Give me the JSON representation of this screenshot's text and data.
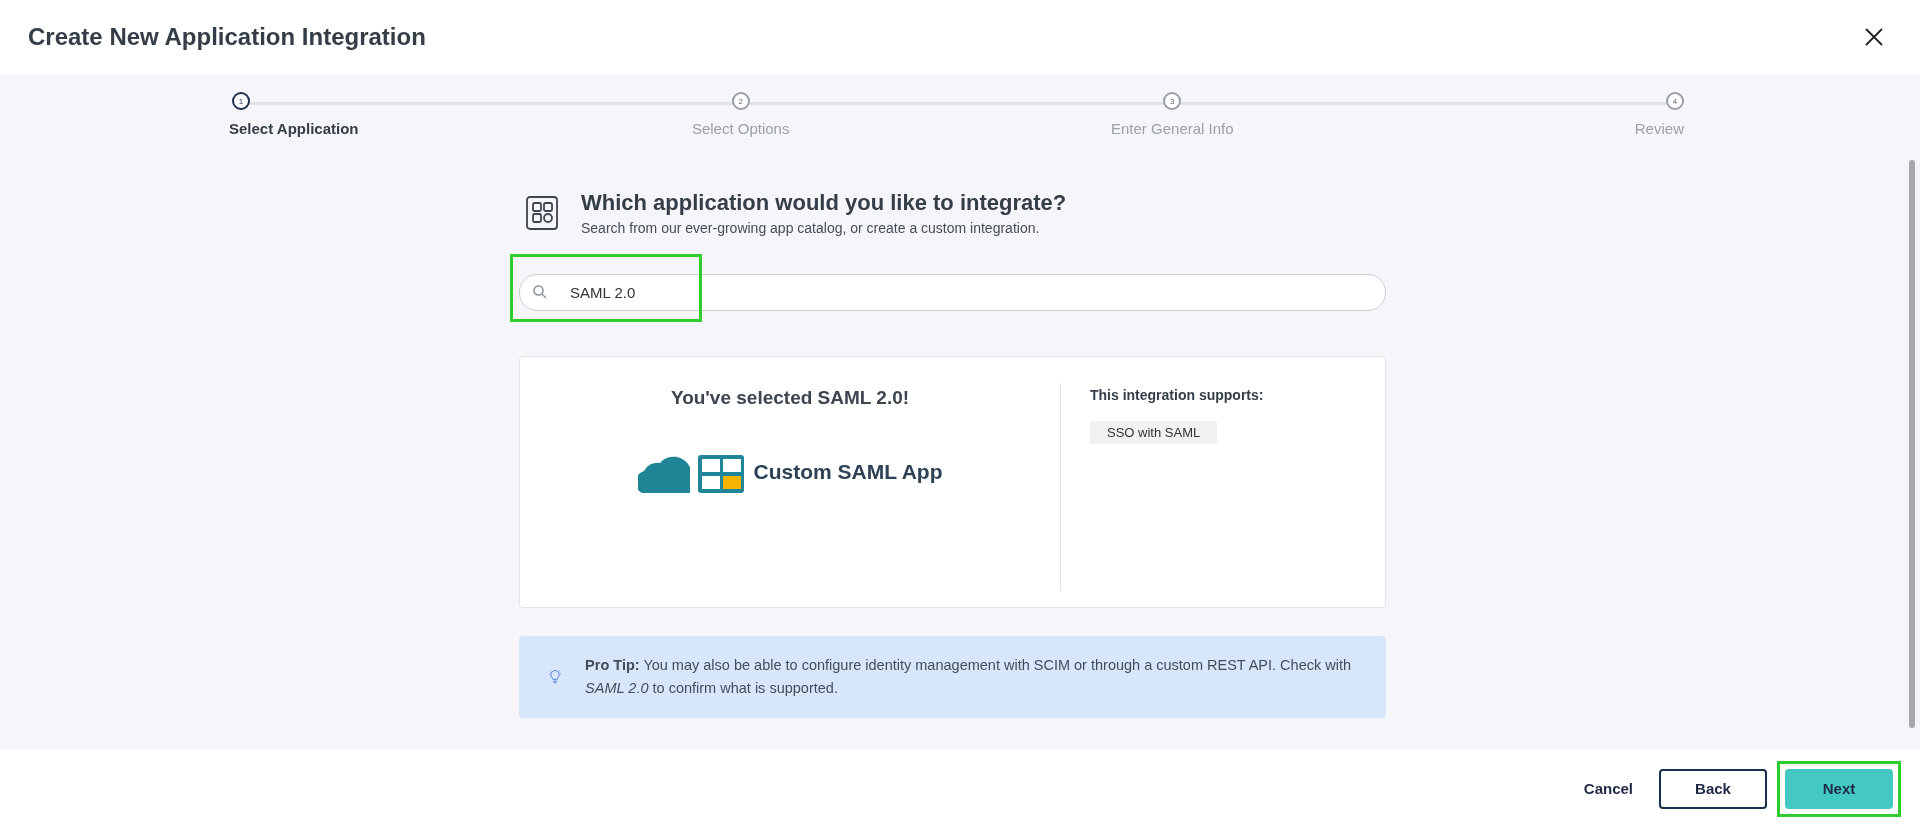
{
  "window": {
    "title": "Create New Application Integration"
  },
  "steps": [
    {
      "number": "1",
      "label": "Select Application",
      "selected": true
    },
    {
      "number": "2",
      "label": "Select Options",
      "selected": false
    },
    {
      "number": "3",
      "label": "Enter General Info",
      "selected": false
    },
    {
      "number": "4",
      "label": "Review",
      "selected": false
    }
  ],
  "heading": {
    "title": "Which application would you like to integrate?",
    "subtitle": "Search from our ever-growing app catalog, or create a custom integration."
  },
  "search": {
    "value": "SAML 2.0",
    "highlighted": true
  },
  "selection": {
    "title": "You've selected SAML 2.0!",
    "app_name": "Custom SAML App",
    "supports_title": "This integration supports:",
    "supports": [
      "SSO with SAML"
    ]
  },
  "tip": {
    "text": "**Pro Tip:** You may also be able to configure identity management with SCIM or through a custom REST API. Check with *SAML 2.0* to confirm what is supported."
  },
  "buttons": [
    {
      "kind": "link",
      "label": "Cancel",
      "highlighted": false
    },
    {
      "kind": "outline",
      "label": "Back",
      "highlighted": false
    },
    {
      "kind": "primary",
      "label": "Next",
      "highlighted": true
    }
  ]
}
